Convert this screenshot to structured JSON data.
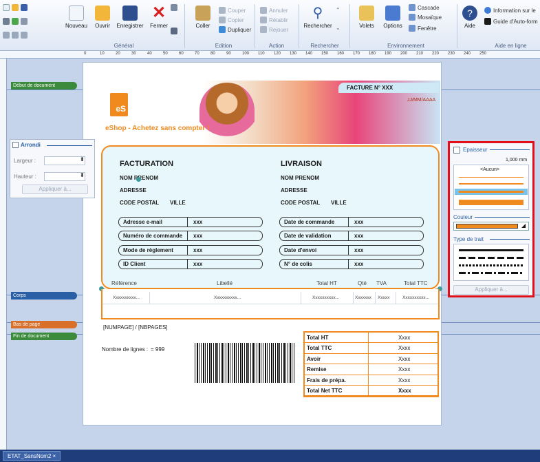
{
  "ribbon": {
    "nouveau": "Nouveau",
    "ouvrir": "Ouvrir",
    "enregistrer": "Enregistrer",
    "fermer": "Fermer",
    "coller": "Coller",
    "couper": "Couper",
    "copier": "Copier",
    "dupliquer": "Dupliquer",
    "annuler": "Annuler",
    "retablir": "Rétablir",
    "rejouer": "Rejouer",
    "rechercher": "Rechercher",
    "volets": "Volets",
    "options": "Options",
    "cascade": "Cascade",
    "mosaique": "Mosaïque",
    "fenetre": "Fenêtre",
    "aide": "Aide",
    "information": "Information sur le",
    "guide": "Guide d'Auto-form",
    "groups": {
      "general": "Général",
      "edition": "Edition",
      "action": "Action",
      "rechercher": "Rechercher",
      "environnement": "Environnement",
      "aide": "Aide en ligne"
    }
  },
  "ruler_ticks": [
    "0",
    "10",
    "20",
    "30",
    "40",
    "50",
    "60",
    "70",
    "80",
    "90",
    "100",
    "110",
    "120",
    "130",
    "140",
    "150",
    "160",
    "170",
    "180",
    "190",
    "200",
    "210",
    "220",
    "230",
    "240",
    "250"
  ],
  "bands": {
    "debut": "Début de document",
    "corps": "Corps",
    "bas": "Bas de page",
    "fin": "Fin de document"
  },
  "invoice": {
    "facture_no": "FACTURE N° XXX",
    "date": "JJ/MM/AAAA",
    "slogan": "eShop - Achetez sans compter !",
    "logo_text": "eS",
    "facturation": "FACTURATION",
    "livraison": "LIVRAISON",
    "nom_prenom": "NOM PRENOM",
    "adresse": "ADRESSE",
    "code_postal": "CODE POSTAL",
    "ville": "VILLE",
    "left_fields": [
      {
        "label": "Adresse e-mail",
        "value": "xxx"
      },
      {
        "label": "Numéro de commande",
        "value": "xxx"
      },
      {
        "label": "Mode de règlement",
        "value": "xxx"
      },
      {
        "label": "ID Client",
        "value": "xxx"
      }
    ],
    "right_fields": [
      {
        "label": "Date de commande",
        "value": "xxx"
      },
      {
        "label": "Date de validation",
        "value": "xxx"
      },
      {
        "label": "Date d'envoi",
        "value": "xxx"
      },
      {
        "label": "N° de colis",
        "value": "xxx"
      }
    ],
    "columns": [
      "Référence",
      "Libellé",
      "Total HT",
      "Qté",
      "TVA",
      "Total TTC"
    ],
    "row": [
      "Xxxxxxxxxx...",
      "Xxxxxxxxxx...",
      "Xxxxxxxxxx...",
      "Xxxxxxx",
      "Xxxxx",
      "Xxxxxxxxxx..."
    ],
    "numpage": "[NUMPAGE] / [NBPAGES]",
    "nb_lignes_label": "Nombre de lignes :",
    "nb_lignes_value": "= 999",
    "totals": [
      {
        "label": "Total HT",
        "value": "Xxxx"
      },
      {
        "label": "Total TTC",
        "value": "Xxxx"
      },
      {
        "label": "Avoir",
        "value": "Xxxx"
      },
      {
        "label": "Remise",
        "value": "Xxxx"
      },
      {
        "label": "Frais de prépa.",
        "value": "Xxxx"
      },
      {
        "label": "Total Net TTC",
        "value": "Xxxx"
      }
    ]
  },
  "arrondi": {
    "title": "Arrondi",
    "largeur": "Largeur :",
    "hauteur": "Hauteur :",
    "apply": "Appliquer à..."
  },
  "epaisseur": {
    "title": "Epaisseur",
    "value": "1,000 mm",
    "aucun": "<Aucun>",
    "couleur": "Couleur",
    "type_trait": "Type de trait",
    "apply": "Appliquer à..."
  },
  "colors": {
    "accent": "#f08a1e",
    "highlight": "#e0101a"
  },
  "taskbar": {
    "tab": "ETAT_SansNom2"
  }
}
